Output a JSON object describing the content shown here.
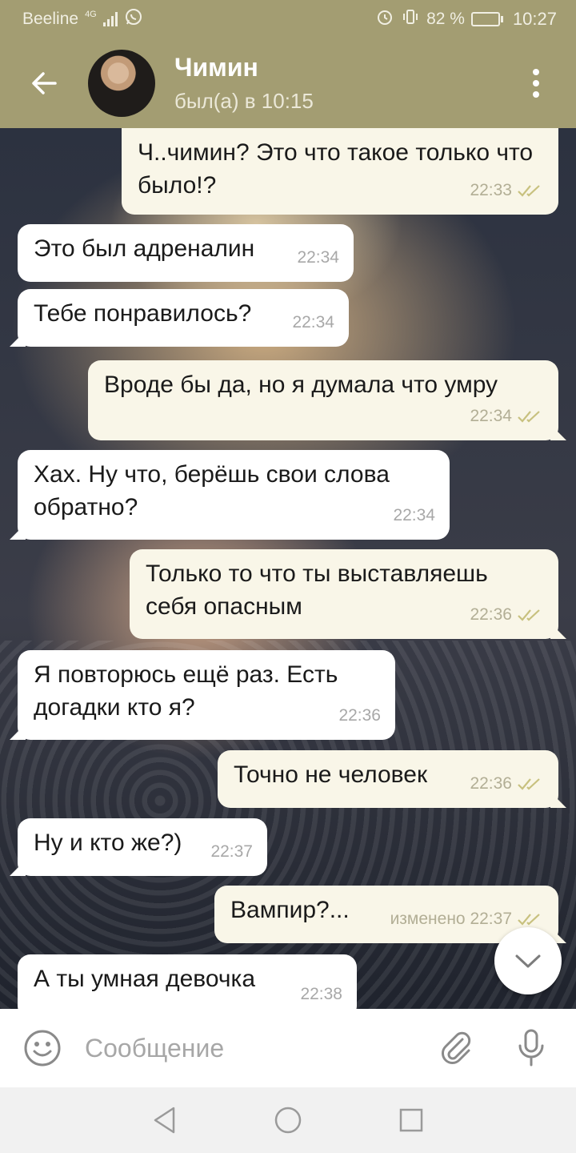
{
  "status_bar": {
    "carrier": "Beeline",
    "network": "4G",
    "battery": "82 %",
    "battery_level": 0.82,
    "time": "10:27"
  },
  "header": {
    "contact_name": "Чимин",
    "last_seen": "был(а) в 10:15"
  },
  "messages": [
    {
      "direction": "outgoing",
      "text": "Ч..чимин? Это что такое только что было!?",
      "time": "22:33",
      "read": true
    },
    {
      "direction": "incoming",
      "text": "Это был адреналин",
      "time": "22:34"
    },
    {
      "direction": "incoming",
      "text": "Тебе понравилось?",
      "time": "22:34"
    },
    {
      "direction": "outgoing",
      "text": "Вроде бы да, но я думала что умру",
      "time": "22:34",
      "read": true
    },
    {
      "direction": "incoming",
      "text": "Хах. Ну что, берёшь свои слова обратно?",
      "time": "22:34"
    },
    {
      "direction": "outgoing",
      "text": "Только то что ты выставляешь себя опасным",
      "time": "22:36",
      "read": true
    },
    {
      "direction": "incoming",
      "text": "Я повторюсь ещё раз. Есть догадки кто я?",
      "time": "22:36"
    },
    {
      "direction": "outgoing",
      "text": "Точно не человек",
      "time": "22:36",
      "read": true
    },
    {
      "direction": "incoming",
      "text": "Ну и кто же?)",
      "time": "22:37"
    },
    {
      "direction": "outgoing",
      "text": "Вампир?...",
      "time": "изменено 22:37",
      "read": true
    },
    {
      "direction": "incoming",
      "text": "А ты умная девочка",
      "time": "22:38"
    }
  ],
  "input": {
    "placeholder": "Сообщение"
  },
  "colors": {
    "header": "#a39d72",
    "incoming_bubble": "#ffffff",
    "outgoing_bubble": "#f9f6e8",
    "read_ticks": "#c8c17f"
  },
  "icons": [
    "back-arrow-icon",
    "more-vert-icon",
    "emoji-icon",
    "attach-icon",
    "mic-icon",
    "chevron-down-icon",
    "nav-back-icon",
    "nav-home-icon",
    "nav-recents-icon",
    "whatsapp-icon",
    "alarm-icon",
    "vibrate-icon"
  ]
}
